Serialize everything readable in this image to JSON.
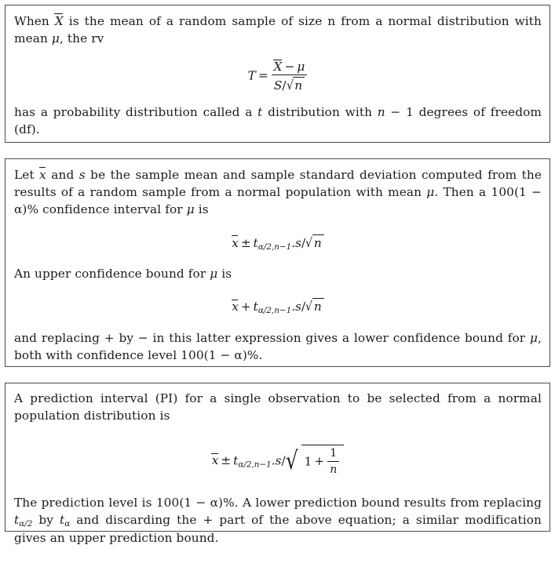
{
  "document": {
    "kind": "statistics-formula-sheet",
    "boxes": [
      {
        "id": "theorem",
        "name": "t-distribution-definition",
        "paragraph_1_a": "When ",
        "paragraph_1_b": " is the mean of a random sample of size n from a normal distribution with mean ",
        "paragraph_1_c": ", the rv",
        "equation": {
          "name": "t-statistic",
          "lhs": "T",
          "relation": "=",
          "numerator_var": "X",
          "numerator_op": "−",
          "numerator_mean": "μ",
          "denominator_s": "S",
          "denominator_slash": "/",
          "denominator_radicand": "n",
          "plain": "T = (X̄ − μ) / (S/√n)"
        },
        "paragraph_2_a": "has a probability distribution called a ",
        "paragraph_2_t": "t",
        "paragraph_2_b": " distribution with ",
        "paragraph_2_n": "n",
        "paragraph_2_minus": " − ",
        "paragraph_2_one": "1",
        "paragraph_2_c": " degrees of freedom (df)."
      },
      {
        "id": "ci",
        "name": "confidence-interval",
        "paragraph_1_a": "Let ",
        "paragraph_1_xbar": "x",
        "paragraph_1_b": " and ",
        "paragraph_1_s": "s",
        "paragraph_1_c": " be the sample mean and sample standard deviation computed from the results of a random sample from a normal population with mean ",
        "paragraph_1_mu": "μ",
        "paragraph_1_d": ". Then a ",
        "paragraph_1_level": "100(1 − α)%",
        "paragraph_1_e": " confidence interval for ",
        "paragraph_1_mu2": "μ",
        "paragraph_1_f": " is",
        "equation_ci": {
          "name": "two-sided-confidence-interval",
          "xbar": "x",
          "operator": "±",
          "t": "t",
          "subscript": "α/2,n−1",
          "dot": ".",
          "s": "s",
          "slash": "/",
          "radicand": "n",
          "plain": "x̄ ± t(α/2,n−1)·s/√n"
        },
        "paragraph_2_a": "An upper confidence bound for ",
        "paragraph_2_mu": "μ",
        "paragraph_2_b": " is",
        "equation_ucb": {
          "name": "upper-confidence-bound",
          "xbar": "x",
          "operator": "+",
          "t": "t",
          "subscript": "α/2,n−1",
          "dot": ".",
          "s": "s",
          "slash": "/",
          "radicand": "n",
          "plain": "x̄ + t(α/2,n−1)·s/√n"
        },
        "paragraph_3_a": "and replacing + by − in this latter expression gives a lower confidence bound for ",
        "paragraph_3_mu": "μ",
        "paragraph_3_b": ", both with confidence level ",
        "paragraph_3_level": "100(1 − α)%",
        "paragraph_3_c": "."
      },
      {
        "id": "pi",
        "name": "prediction-interval",
        "paragraph_1": "A prediction interval (PI) for a single observation to be selected from a normal population distribution is",
        "equation_pi": {
          "name": "prediction-interval-formula",
          "xbar": "x",
          "operator": "±",
          "t": "t",
          "subscript": "α/2,n−1",
          "dot": ".",
          "s": "s",
          "slash": "/",
          "radicand_one": "1",
          "radicand_plus": "+",
          "radicand_frac_num": "1",
          "radicand_frac_den": "n",
          "plain": "x̄ ± t(α/2,n−1)·s/√(1 + 1/n)"
        },
        "paragraph_2_a": "The prediction level is ",
        "paragraph_2_level": "100(1 − α)%",
        "paragraph_2_b": ". A lower prediction bound results from replacing ",
        "paragraph_2_t1": "t",
        "paragraph_2_t1sub": "α/2",
        "paragraph_2_c": " by ",
        "paragraph_2_t2": "t",
        "paragraph_2_t2sub": "α",
        "paragraph_2_d": " and discarding the + part of the above equation; a similar modification gives an upper prediction bound."
      }
    ]
  },
  "style": {
    "border_color": "#4a4a52",
    "text_color": "#1a1a22",
    "background": "#ffffff"
  }
}
